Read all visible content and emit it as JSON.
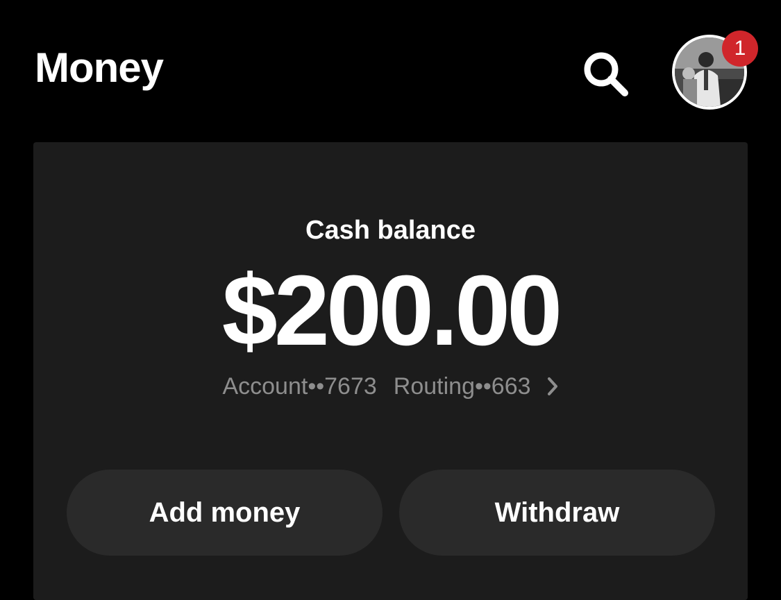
{
  "header": {
    "title": "Money",
    "search_icon": "search-icon",
    "notification_count": "1"
  },
  "balance": {
    "label": "Cash balance",
    "amount": "$200.00",
    "account_label": "Account",
    "account_masked": "••7673",
    "routing_label": "Routing",
    "routing_masked": "••663",
    "chevron_icon": "chevron-right-icon"
  },
  "actions": {
    "add_money": "Add money",
    "withdraw": "Withdraw"
  },
  "colors": {
    "background": "#000000",
    "card": "#1c1c1c",
    "button": "#2a2a2a",
    "badge": "#d0262b",
    "muted_text": "#8e8e8e"
  }
}
